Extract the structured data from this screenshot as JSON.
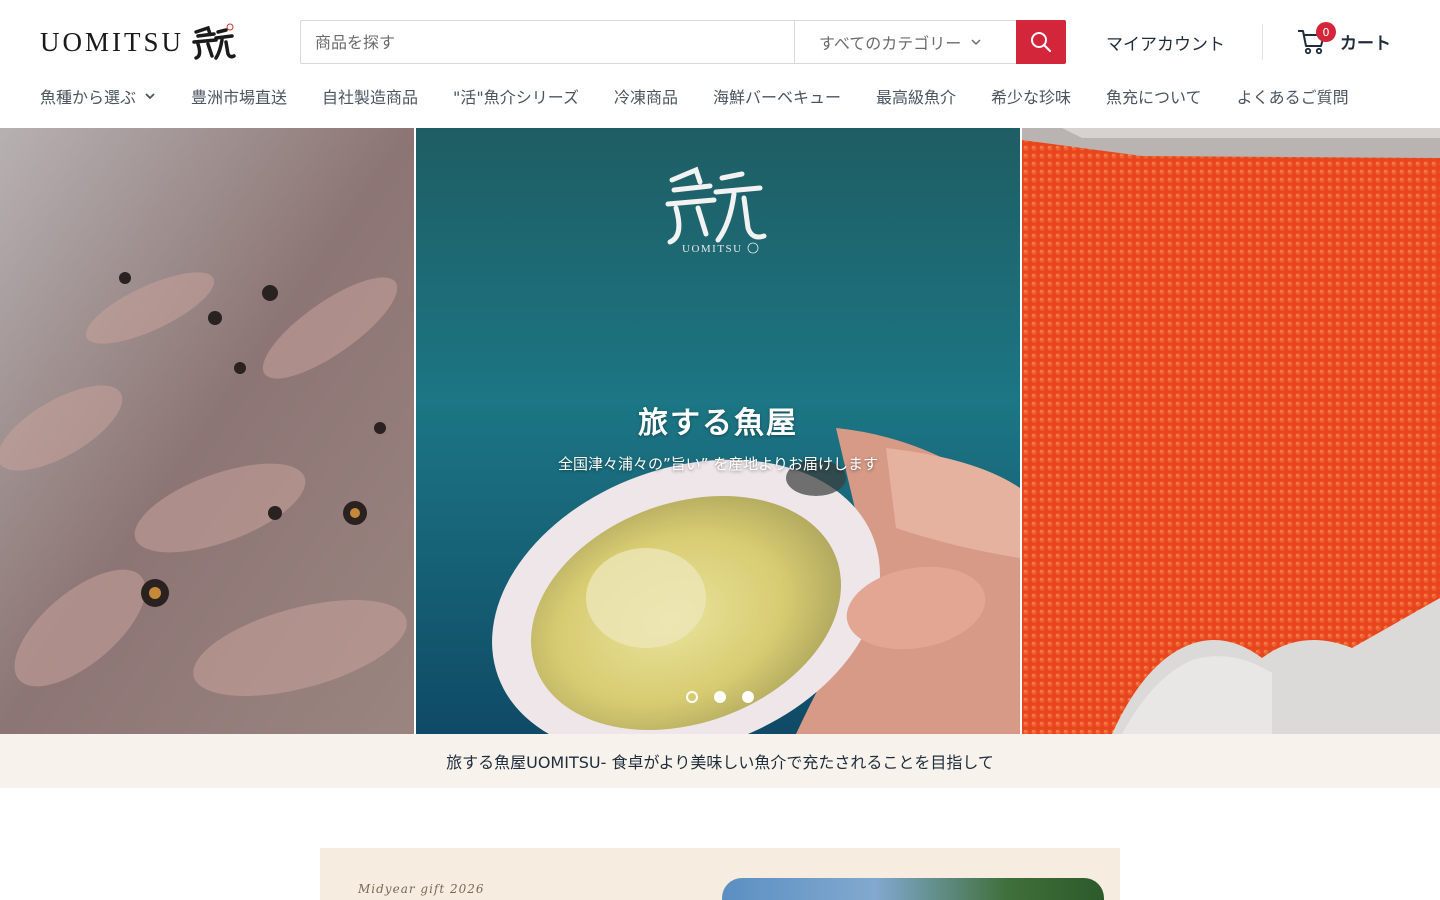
{
  "header": {
    "logo_text": "UOMITSU",
    "search_placeholder": "商品を探す",
    "search_category": "すべてのカテゴリー",
    "account_label": "マイアカウント",
    "cart_count": "0",
    "cart_label": "カート"
  },
  "nav": {
    "items": [
      {
        "label": "魚種から選ぶ"
      },
      {
        "label": "豊洲市場直送"
      },
      {
        "label": "自社製造商品"
      },
      {
        "label": "\"活\"魚介シリーズ"
      },
      {
        "label": "冷凍商品"
      },
      {
        "label": "海鮮バーベキュー"
      },
      {
        "label": "最高級魚介"
      },
      {
        "label": "希少な珍味"
      },
      {
        "label": "魚充について"
      },
      {
        "label": "よくあるご質問"
      }
    ]
  },
  "hero": {
    "brand_small": "UOMITSU",
    "title": "旅する魚屋",
    "subtitle": "全国津々浦々の”旨い” を産地よりお届けします",
    "slide_count": 3,
    "active_slide": 1
  },
  "announcement": {
    "text": "旅する魚屋UOMITSU- 食卓がより美味しい魚介で充たされることを目指して"
  },
  "promo": {
    "label": "Midyear gift 2026"
  },
  "colors": {
    "accent": "#d3263b",
    "announce_bg": "#f7f2eb",
    "text": "#1e2d3d"
  }
}
